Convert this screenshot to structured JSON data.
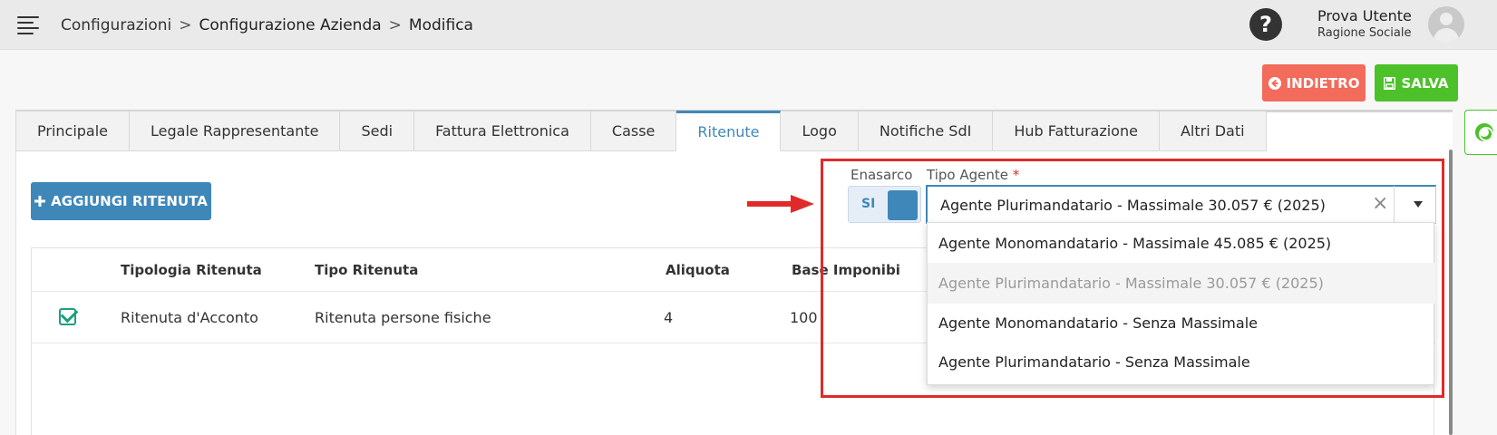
{
  "header": {
    "breadcrumb": [
      "Configurazioni",
      "Configurazione Azienda",
      "Modifica"
    ],
    "help_glyph": "?",
    "user_name": "Prova Utente",
    "company": "Ragione Sociale"
  },
  "actions": {
    "back_label": "INDIETRO",
    "save_label": "SALVA",
    "back_color": "#f26b5b",
    "save_color": "#4cc12a"
  },
  "tabs": [
    {
      "label": "Principale"
    },
    {
      "label": "Legale Rappresentante"
    },
    {
      "label": "Sedi"
    },
    {
      "label": "Fattura Elettronica"
    },
    {
      "label": "Casse"
    },
    {
      "label": "Ritenute",
      "active": true
    },
    {
      "label": "Logo"
    },
    {
      "label": "Notifiche SdI"
    },
    {
      "label": "Hub Fatturazione"
    },
    {
      "label": "Altri Dati"
    }
  ],
  "ritenute": {
    "add_label": "AGGIUNGI RITENUTA",
    "columns": [
      "Tipologia Ritenuta",
      "Tipo Ritenuta",
      "Aliquota",
      "Base Imponibi"
    ],
    "rows": [
      {
        "checked": true,
        "tipologia": "Ritenuta d'Acconto",
        "tipo": "Ritenuta persone fisiche",
        "aliquota": "4",
        "base": "100"
      }
    ]
  },
  "form": {
    "enasarco_label": "Enasarco",
    "enasarco_value": "SI",
    "tipo_agente_label": "Tipo Agente",
    "required_mark": "*",
    "tipo_agente_value": "Agente Plurimandatario - Massimale 30.057 € (2025)",
    "clear_glyph": "×",
    "options": [
      {
        "label": "Agente Monomandatario - Massimale 45.085 € (2025)",
        "disabled": false
      },
      {
        "label": "Agente Plurimandatario - Massimale 30.057 € (2025)",
        "disabled": true
      },
      {
        "label": "Agente Monomandatario - Senza Massimale",
        "disabled": false
      },
      {
        "label": "Agente Plurimandatario - Senza Massimale",
        "disabled": false
      }
    ]
  },
  "icons": {
    "menu": "hamburger-icon",
    "help": "question-circle-icon",
    "back": "arrow-left-icon",
    "save": "floppy-disk-icon",
    "add": "plus-icon",
    "check": "check-square-icon",
    "support": "life-ring-icon",
    "annotation": "red-arrow-icon"
  },
  "colors": {
    "accent": "#3f87b8",
    "annotation": "#e02a2a",
    "check": "#1e9e81"
  }
}
